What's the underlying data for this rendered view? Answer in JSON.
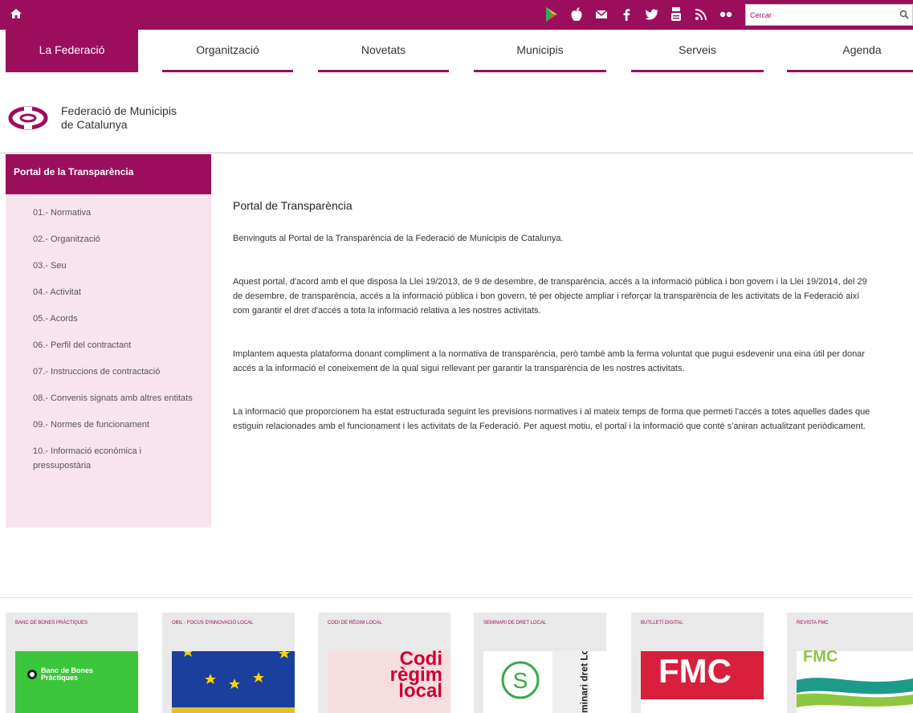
{
  "topbar": {
    "search": {
      "placeholder": "Cercar"
    },
    "social_icons": [
      "google-play-icon",
      "apple-icon",
      "mail-icon",
      "facebook-icon",
      "twitter-icon",
      "youtube-icon",
      "rss-icon",
      "flickr-icon"
    ]
  },
  "nav": {
    "items": [
      {
        "label": "La Federació"
      },
      {
        "label": "Organització"
      },
      {
        "label": "Novetats"
      },
      {
        "label": "Municipis"
      },
      {
        "label": "Serveis"
      },
      {
        "label": "Agenda"
      }
    ]
  },
  "logo": {
    "line1": "Federació de Municipis",
    "line2": "de Catalunya"
  },
  "sidebar": {
    "title": "Portal de la Transparència",
    "items": [
      {
        "label": "01.- Normativa"
      },
      {
        "label": "02.- Organització"
      },
      {
        "label": "03.- Seu"
      },
      {
        "label": "04.- Activitat"
      },
      {
        "label": "05.- Acords"
      },
      {
        "label": "06.- Perfil del contractant"
      },
      {
        "label": "07.- Instruccions de contractació"
      },
      {
        "label": "08.- Convenis signats amb altres entitats"
      },
      {
        "label": "09.- Normes de funcionament"
      },
      {
        "label": "10.- Informació econòmica i pressupostària"
      }
    ]
  },
  "content": {
    "title": "Portal de Transparència",
    "paragraphs": [
      "Benvinguts al Portal de la Transparència de la Federació de Municipis de Catalunya.",
      "Aquest portal, d'acord amb el que disposa la Llei 19/2013, de 9 de desembre, de transparència, accés a la informació pública i bon govern i la Llei 19/2014, del 29 de desembre, de transparència, accés a la informació pública i bon govern, té per objecte ampliar i reforçar la transparència de les activitats de la Federació així com garantir el dret d'accés a tota la informació relativa a les nostres activitats.",
      "Implantem aquesta plataforma donant compliment a la normativa de transparència, però també amb la ferma voluntat que pugui esdevenir una eina útil per donar accés a la informació el coneixement de la qual sigui rellevant per garantir la transparència de les nostres activitats.",
      "La informació que proporcionem ha estat estructurada seguint les previsions normatives i al mateix temps de forma que permeti l'accés a totes aquelles dades que estiguin relacionades amb el funcionament i les activitats de la Federació. Per aquest motiu, el portal i la informació que conté s'aniran actualitzant periòdicament."
    ]
  },
  "tiles": [
    {
      "label": "Banc de Bones Pràctiques",
      "img_text": "Banc de Bones Pràctiques",
      "color": "#3cc63c"
    },
    {
      "label": "OBIL - Focus d'innovació local",
      "img_text": "",
      "color": "#1b3f9c"
    },
    {
      "label": "Codi de règim local",
      "img_text": "Codi règim local",
      "color": "#cc0033"
    },
    {
      "label": "Seminari de dret local",
      "img_text": "Seminari dret Local",
      "color": "#3aa84a"
    },
    {
      "label": "Butlletí digital",
      "img_text": "FMC",
      "color": "#d81f3c"
    },
    {
      "label": "Revista FMC",
      "img_text": "FMC",
      "color": "#8dc63f"
    }
  ],
  "colors": {
    "brand": "#9b0e5c",
    "sidebar_bg": "#f7e4ef"
  }
}
